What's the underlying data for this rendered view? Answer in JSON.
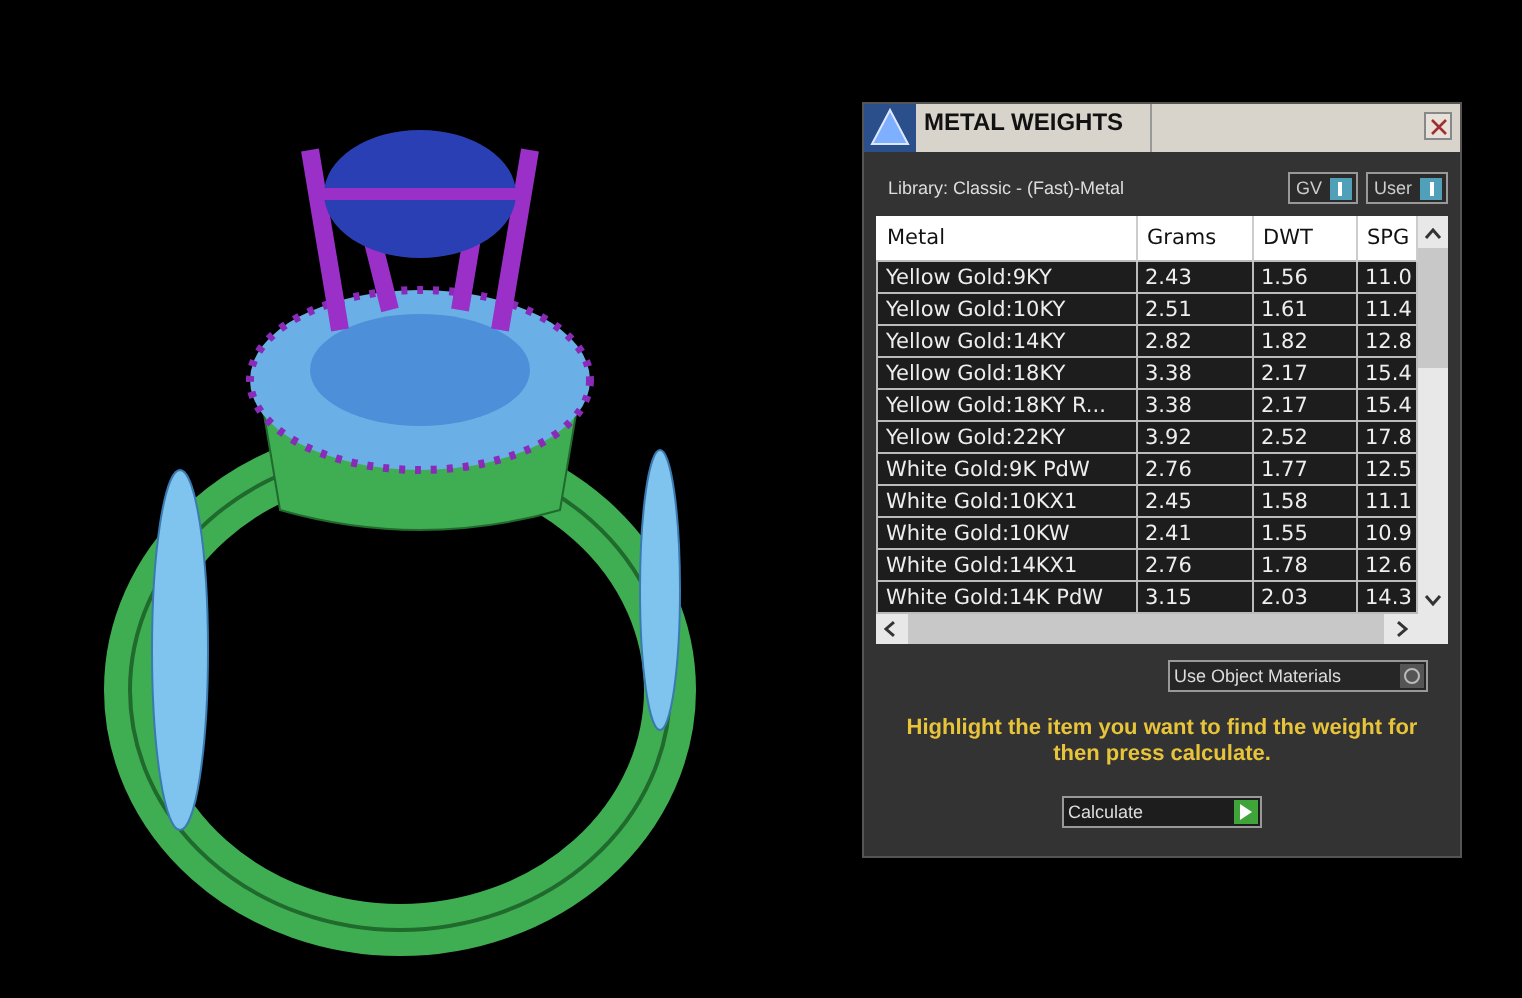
{
  "window": {
    "title": "METAL WEIGHTS"
  },
  "library": "Library: Classic - (Fast)-Metal",
  "toggles": [
    {
      "label": "GV",
      "on": true
    },
    {
      "label": "User",
      "on": true
    }
  ],
  "table": {
    "columns": [
      "Metal",
      "Grams",
      "DWT",
      "SPG"
    ],
    "rows": [
      {
        "cells": [
          "Yellow Gold:9KY",
          "2.43",
          "1.56",
          "11.0"
        ],
        "selected": false
      },
      {
        "cells": [
          "Yellow Gold:10KY",
          "2.51",
          "1.61",
          "11.4"
        ],
        "selected": false
      },
      {
        "cells": [
          "Yellow Gold:14KY",
          "2.82",
          "1.82",
          "12.8"
        ],
        "selected": false
      },
      {
        "cells": [
          "Yellow Gold:18KY",
          "3.38",
          "2.17",
          "15.4"
        ],
        "selected": false
      },
      {
        "cells": [
          "Yellow Gold:18KY R...",
          "3.38",
          "2.17",
          "15.4"
        ],
        "selected": false
      },
      {
        "cells": [
          "Yellow Gold:22KY",
          "3.92",
          "2.52",
          "17.8"
        ],
        "selected": false
      },
      {
        "cells": [
          "White Gold:9K PdW",
          "2.76",
          "1.77",
          "12.5"
        ],
        "selected": false
      },
      {
        "cells": [
          "White Gold:10KX1",
          "2.45",
          "1.58",
          "11.1"
        ],
        "selected": false
      },
      {
        "cells": [
          "White Gold:10KW",
          "2.41",
          "1.55",
          "10.9"
        ],
        "selected": false
      },
      {
        "cells": [
          "White Gold:14KX1",
          "2.76",
          "1.78",
          "12.6"
        ],
        "selected": false
      },
      {
        "cells": [
          "White Gold:14K PdW",
          "3.15",
          "2.03",
          "14.3"
        ],
        "selected": false
      }
    ]
  },
  "use_object_materials": {
    "label": "Use Object Materials",
    "on": false
  },
  "hint": "Highlight the item you want to find the weight for then press calculate.",
  "calculate_button": "Calculate"
}
